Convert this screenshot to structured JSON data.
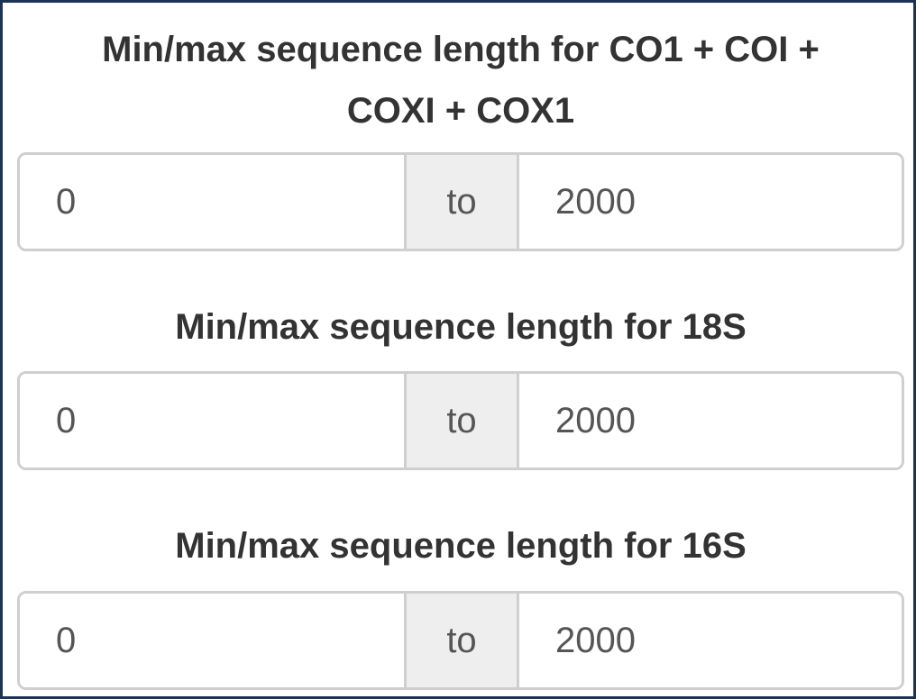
{
  "filters": [
    {
      "title_line1": "Min/max sequence length for CO1 + COI +",
      "title_line2": "COXI + COX1",
      "min_value": "0",
      "separator": "to",
      "max_value": "2000"
    },
    {
      "title_line1": "Min/max sequence length for 18S",
      "min_value": "0",
      "separator": "to",
      "max_value": "2000"
    },
    {
      "title_line1": "Min/max sequence length for 16S",
      "min_value": "0",
      "separator": "to",
      "max_value": "2000"
    }
  ],
  "colors": {
    "frame_border": "#1c3354",
    "title_text": "#333333",
    "input_text": "#555555",
    "input_border": "#cfcfcf",
    "addon_background": "#eeeeee"
  }
}
